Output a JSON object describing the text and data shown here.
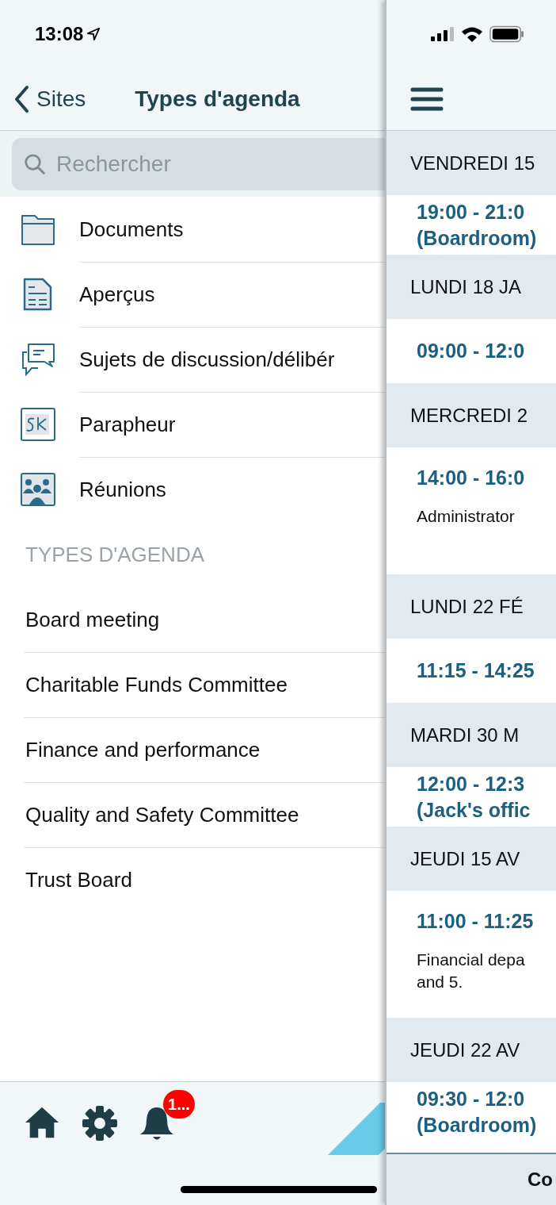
{
  "status_bar": {
    "time": "13:08"
  },
  "nav": {
    "back": "Sites",
    "title": "Types d'agenda"
  },
  "search": {
    "placeholder": "Rechercher"
  },
  "menu": [
    {
      "kind": "folder",
      "label": "Documents"
    },
    {
      "kind": "document",
      "label": "Aperçus"
    },
    {
      "kind": "discussion",
      "label": "Sujets de discussion/délibér"
    },
    {
      "kind": "signature",
      "label": "Parapheur"
    },
    {
      "kind": "meetings",
      "label": "Réunions"
    }
  ],
  "section_header": "TYPES D'AGENDA",
  "agenda_types": [
    "Board meeting",
    "Charitable Funds Committee",
    "Finance and performance",
    "Quality and Safety Committee",
    "Trust Board"
  ],
  "tab_bar": {
    "badge": "1..."
  },
  "agenda": [
    {
      "kind": "header",
      "text": "VENDREDI 15"
    },
    {
      "kind": "event",
      "time": "19:00 - 21:0",
      "location": "(Boardroom)"
    },
    {
      "kind": "header",
      "text": "LUNDI 18 JA"
    },
    {
      "kind": "event",
      "time": "09:00 - 12:0"
    },
    {
      "kind": "header",
      "text": "MERCREDI 2"
    },
    {
      "kind": "event",
      "time": "14:00 - 16:0",
      "description": [
        "Administrator"
      ]
    },
    {
      "kind": "header",
      "text": "LUNDI 22 FÉ"
    },
    {
      "kind": "event",
      "time": "11:15 - 14:25"
    },
    {
      "kind": "header",
      "text": "MARDI 30 M"
    },
    {
      "kind": "event",
      "time": "12:00 - 12:3",
      "location": "(Jack's offic"
    },
    {
      "kind": "header",
      "text": "JEUDI 15 AV"
    },
    {
      "kind": "event",
      "time": "11:00 - 11:25",
      "description": [
        "Financial depa",
        "and 5."
      ]
    },
    {
      "kind": "header",
      "text": "JEUDI 22 AV"
    },
    {
      "kind": "event",
      "time": "09:30 - 12:0",
      "location": "(Boardroom)"
    }
  ],
  "bottom_bar": {
    "label": "Co"
  }
}
